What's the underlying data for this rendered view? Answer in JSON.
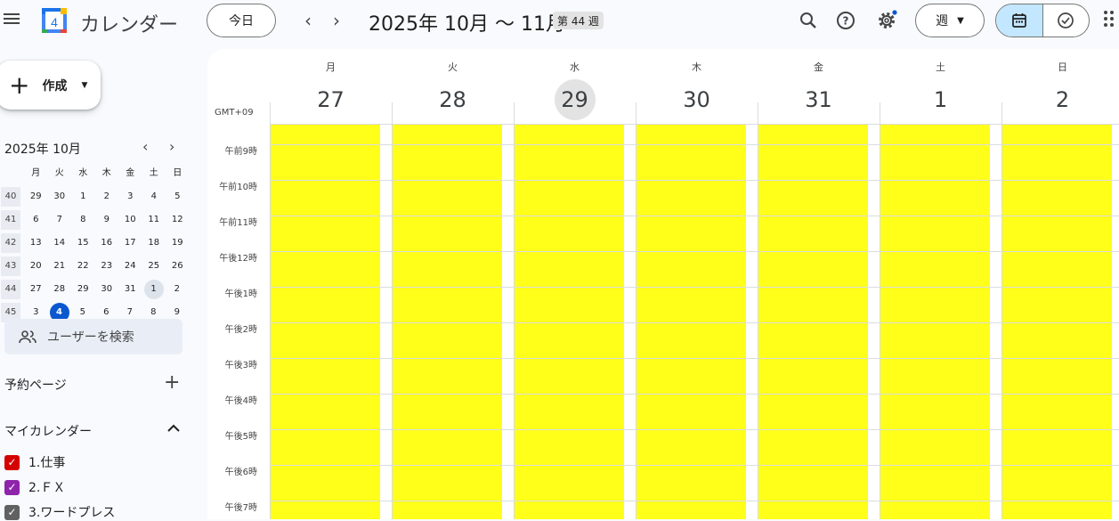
{
  "header": {
    "app_title": "カレンダー",
    "logo_number": "4",
    "today_label": "今日",
    "date_range": "2025年 10月 〜 11月",
    "week_badge": "第 44 週",
    "view_label": "週",
    "icons": [
      "menu-icon",
      "search-icon",
      "help-icon",
      "settings-icon",
      "calendar-view-icon",
      "tasks-view-icon",
      "apps-icon"
    ]
  },
  "sidebar": {
    "create_label": "作成",
    "mini_calendar": {
      "title": "2025年 10月",
      "weekdays": [
        "月",
        "火",
        "水",
        "木",
        "金",
        "土",
        "日"
      ],
      "weeks": [
        {
          "num": "40",
          "days": [
            "29",
            "30",
            "1",
            "2",
            "3",
            "4",
            "5"
          ]
        },
        {
          "num": "41",
          "days": [
            "6",
            "7",
            "8",
            "9",
            "10",
            "11",
            "12"
          ]
        },
        {
          "num": "42",
          "days": [
            "13",
            "14",
            "15",
            "16",
            "17",
            "18",
            "19"
          ]
        },
        {
          "num": "43",
          "days": [
            "20",
            "21",
            "22",
            "23",
            "24",
            "25",
            "26"
          ]
        },
        {
          "num": "44",
          "days": [
            "27",
            "28",
            "29",
            "30",
            "31",
            "1",
            "2"
          ]
        },
        {
          "num": "45",
          "days": [
            "3",
            "4",
            "5",
            "6",
            "7",
            "8",
            "9"
          ]
        }
      ],
      "selected_day": "4",
      "highlighted_day": "1"
    },
    "search_users": "ユーザーを検索",
    "booking_pages": "予約ページ",
    "my_calendars": "マイカレンダー",
    "calendars": [
      {
        "name": "1.仕事",
        "color": "#d50000"
      },
      {
        "name": "2.ＦＸ",
        "color": "#8e24aa"
      },
      {
        "name": "3.ワードプレス",
        "color": "#616161"
      }
    ]
  },
  "week_view": {
    "timezone": "GMT+09",
    "days": [
      {
        "name": "月",
        "num": "27"
      },
      {
        "name": "火",
        "num": "28"
      },
      {
        "name": "水",
        "num": "29"
      },
      {
        "name": "木",
        "num": "30"
      },
      {
        "name": "金",
        "num": "31"
      },
      {
        "name": "土",
        "num": "1"
      },
      {
        "name": "日",
        "num": "2"
      }
    ],
    "today_index": 2,
    "hours": [
      "午前9時",
      "午前10時",
      "午前11時",
      "午後12時",
      "午後1時",
      "午後2時",
      "午後3時",
      "午後4時",
      "午後5時",
      "午後6時",
      "午後7時"
    ],
    "event_color": "#ffff1a"
  }
}
